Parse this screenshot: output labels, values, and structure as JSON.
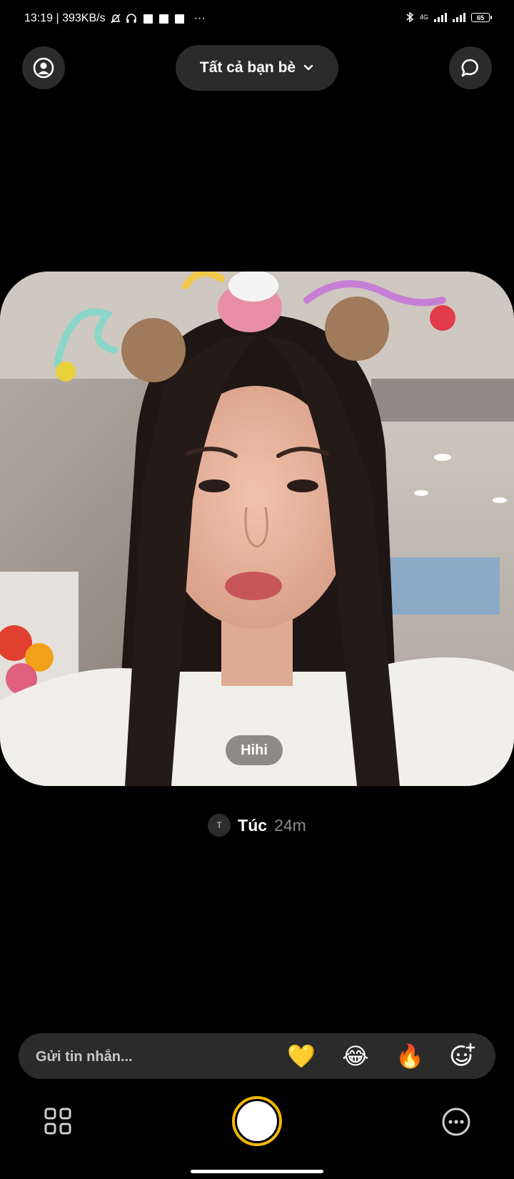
{
  "status_bar": {
    "time_speed": "13:19 | 393KB/s",
    "network_label": "4G",
    "battery": "65",
    "more_dots": "···"
  },
  "header": {
    "friends_filter_label": "Tất cả bạn bè"
  },
  "post": {
    "caption": "Hihi",
    "sender_initial": "T",
    "sender_name": "Túc",
    "time_ago": "24m"
  },
  "message_bar": {
    "placeholder": "Gửi tin nhắn...",
    "reactions": [
      "💛",
      "😂",
      "🔥"
    ]
  },
  "colors": {
    "background": "#000000",
    "control_bg": "#2b2b2b",
    "accent_ring": "#f5b800",
    "muted_text": "#8a8a8a"
  },
  "icons": {
    "profile": "person-circle-icon",
    "chat": "chat-bubble-icon",
    "dropdown": "chevron-down-icon",
    "add_reaction": "smiley-plus-icon",
    "grid": "grid-icon",
    "more": "more-dots-icon"
  }
}
